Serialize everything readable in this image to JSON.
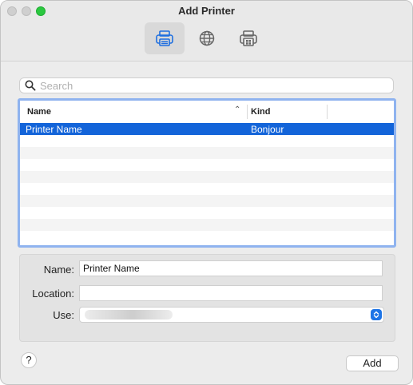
{
  "window": {
    "title": "Add Printer",
    "toolbar": [
      {
        "icon": "printer-icon",
        "selected": true
      },
      {
        "icon": "globe-icon",
        "selected": false
      },
      {
        "icon": "printer-windows-icon",
        "selected": false
      }
    ]
  },
  "search": {
    "placeholder": "Search",
    "value": ""
  },
  "list": {
    "columns": [
      {
        "label": "Name",
        "sort": "ascending"
      },
      {
        "label": "Kind"
      }
    ],
    "rows": [
      {
        "name": "Printer Name",
        "kind": "Bonjour",
        "selected": true
      }
    ],
    "selection_color": "#1364d9"
  },
  "form": {
    "name_label": "Name:",
    "name_value": "Printer Name",
    "location_label": "Location:",
    "location_value": "",
    "use_label": "Use:",
    "use_value": ""
  },
  "buttons": {
    "help": "?",
    "add": "Add"
  },
  "colors": {
    "accent": "#1d74e6",
    "focus_ring": "#8fb3ef"
  }
}
